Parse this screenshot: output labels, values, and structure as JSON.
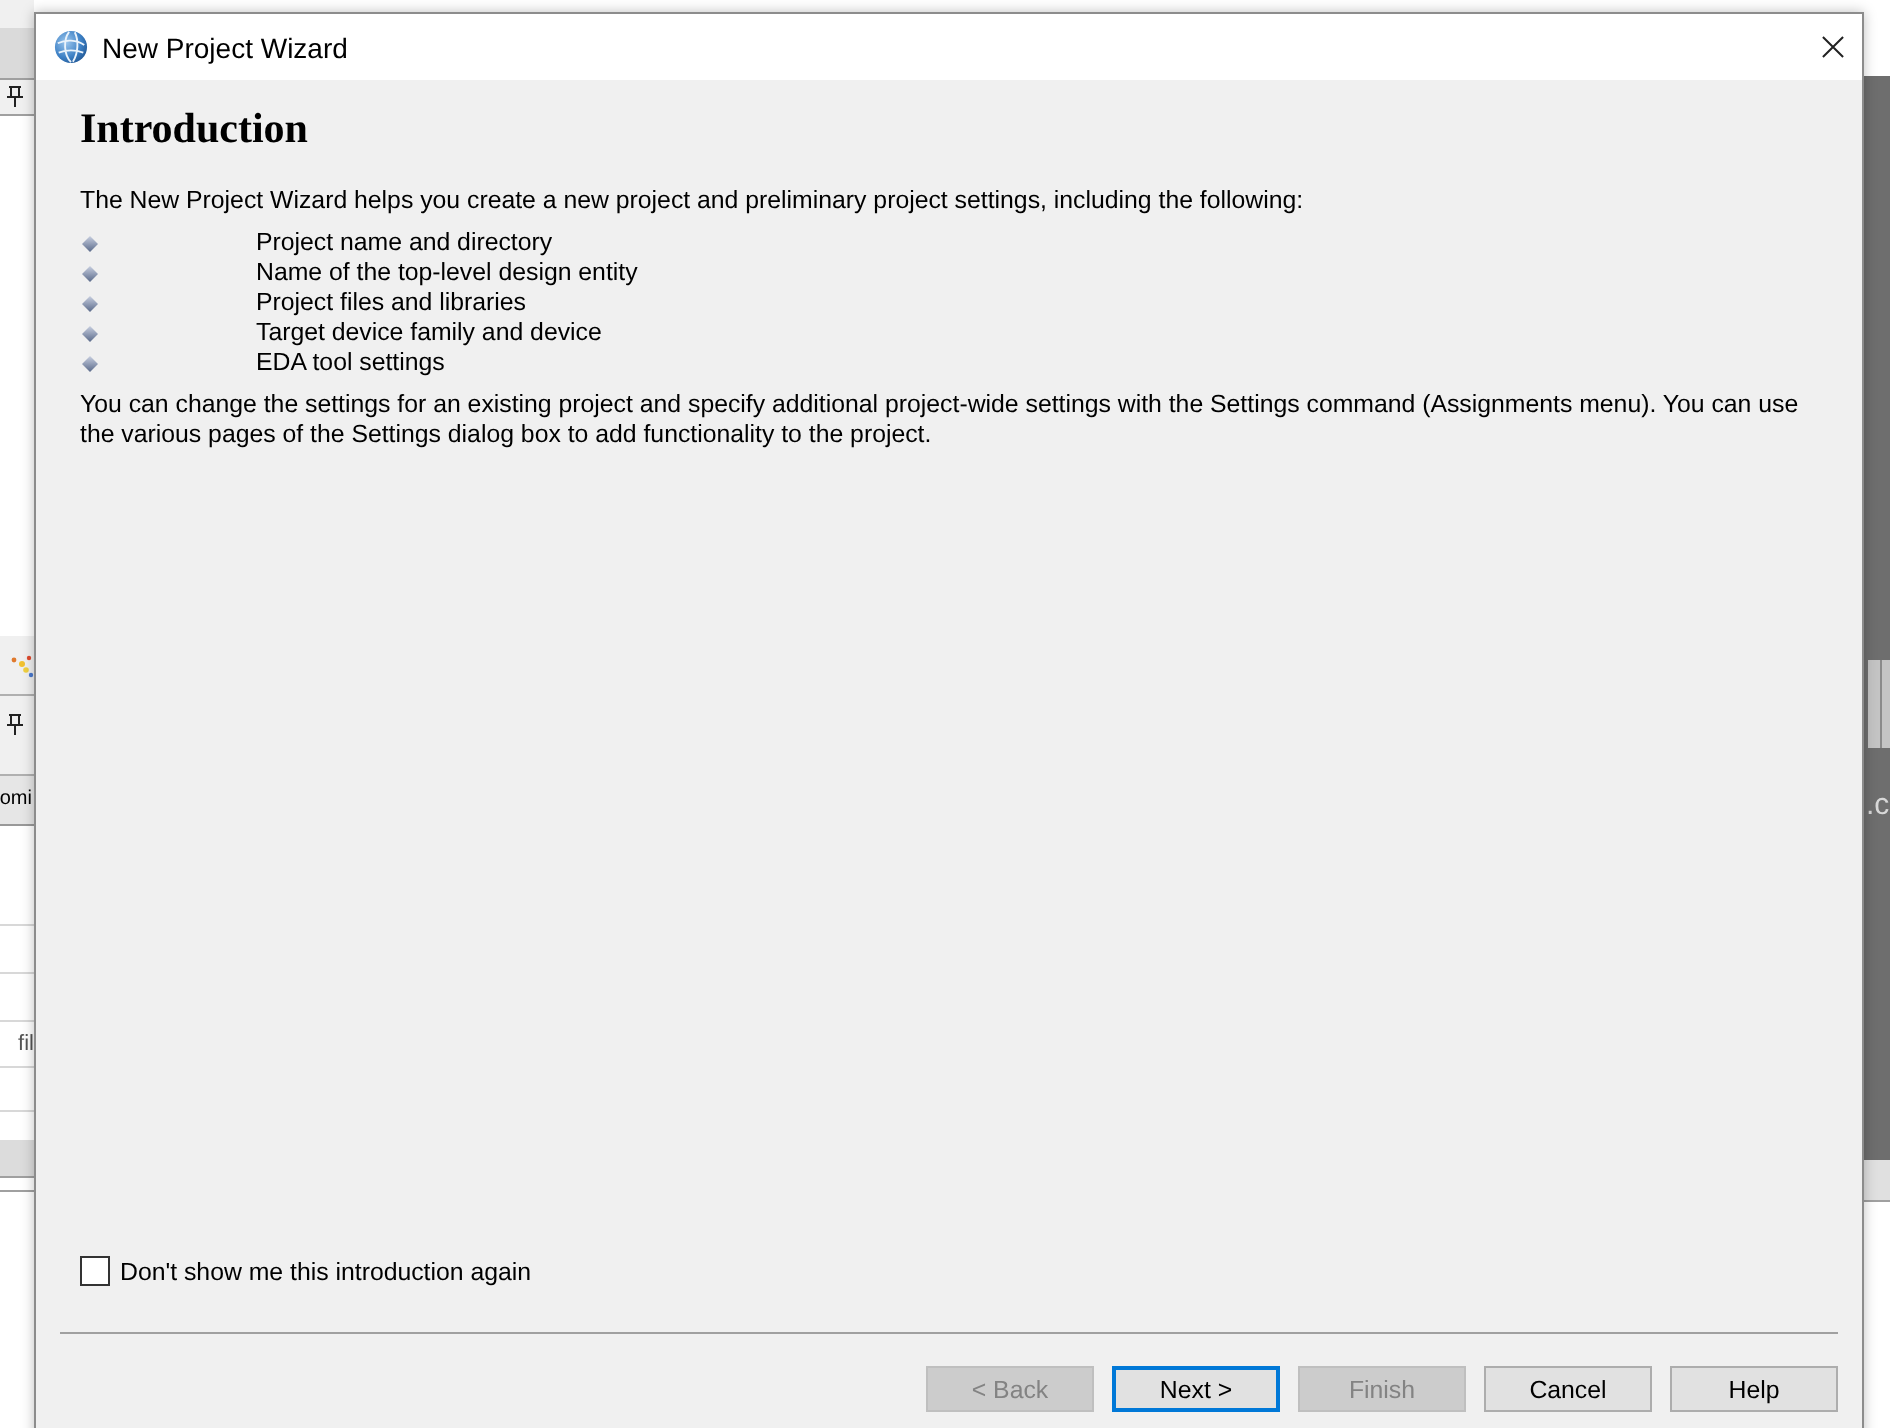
{
  "window": {
    "title": "New Project Wizard"
  },
  "page": {
    "heading": "Introduction",
    "intro": "The New Project Wizard helps you create a new project and preliminary project settings, including the following:",
    "items": [
      "Project name and directory",
      "Name of the top-level design entity",
      "Project files and libraries",
      "Target device family and device",
      "EDA tool settings"
    ],
    "note": "You can change the settings for an existing project and specify additional project-wide settings with the Settings command (Assignments menu). You can use the various pages of the Settings dialog box to add functionality to the project."
  },
  "options": [
    {
      "label": "Don't show me this introduction again",
      "checked": false
    }
  ],
  "buttons": [
    {
      "label": "< Back",
      "disabled": true,
      "focused": false
    },
    {
      "label": "Next >",
      "disabled": false,
      "focused": true
    },
    {
      "label": "Finish",
      "disabled": true,
      "focused": false
    },
    {
      "label": "Cancel",
      "disabled": false,
      "focused": false
    },
    {
      "label": "Help",
      "disabled": false,
      "focused": false
    }
  ],
  "background": {
    "left_tab": "omi",
    "left_text": "fil",
    "right_text": ".c"
  }
}
